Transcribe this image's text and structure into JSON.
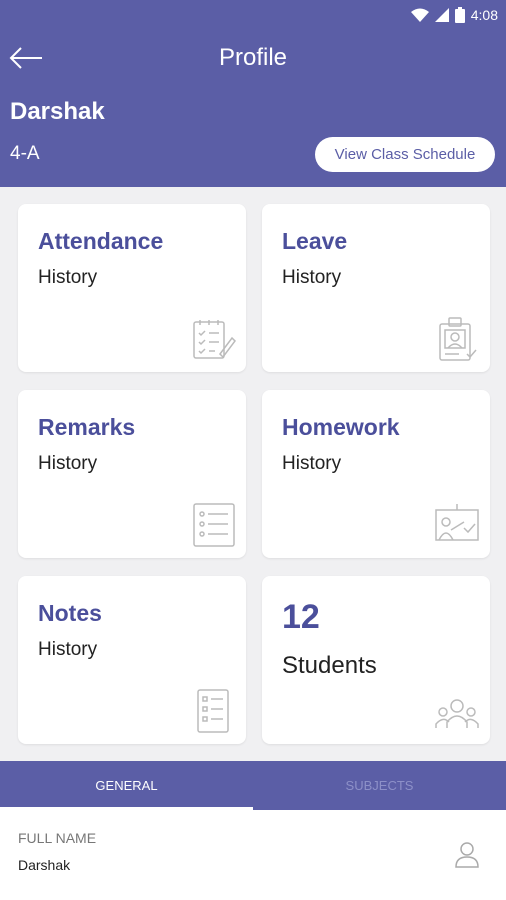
{
  "status_bar": {
    "time": "4:08"
  },
  "header": {
    "title": "Profile",
    "user_name": "Darshak",
    "user_class": "4-A",
    "schedule_button": "View Class Schedule"
  },
  "cards": [
    {
      "title": "Attendance",
      "subtitle": "History",
      "icon": "attendance-icon"
    },
    {
      "title": "Leave",
      "subtitle": "History",
      "icon": "id-card-icon"
    },
    {
      "title": "Remarks",
      "subtitle": "History",
      "icon": "checklist-icon"
    },
    {
      "title": "Homework",
      "subtitle": "History",
      "icon": "presentation-icon"
    },
    {
      "title": "Notes",
      "subtitle": "History",
      "icon": "notes-icon"
    },
    {
      "count": "12",
      "label": "Students",
      "icon": "students-group-icon"
    }
  ],
  "tabs": [
    {
      "label": "GENERAL",
      "active": true
    },
    {
      "label": "SUBJECTS",
      "active": false
    }
  ],
  "details": {
    "full_name_label": "FULL NAME",
    "full_name_value": "Darshak"
  },
  "colors": {
    "primary": "#5b5ea6",
    "accent_text": "#4b4f9b",
    "background": "#f0f0f2"
  }
}
